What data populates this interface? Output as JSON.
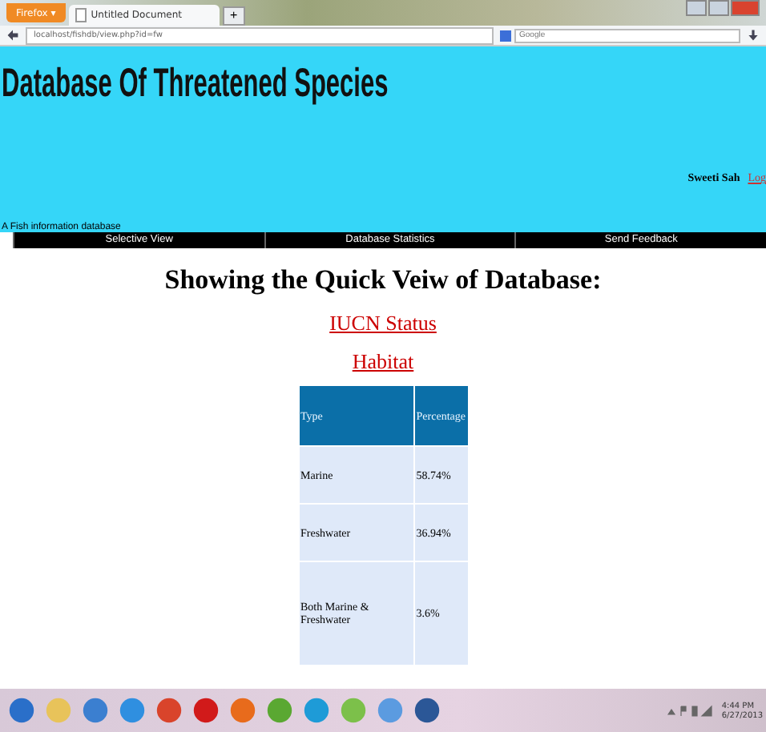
{
  "browser": {
    "menu_button": "Firefox ▾",
    "tabs": [
      {
        "title": "Untitled Document",
        "selected": true
      }
    ],
    "new_tab": "+",
    "url": "localhost/fishdb/view.php?id=fw",
    "search_placeholder": "Google"
  },
  "site": {
    "title": "Database Of Threatened Species",
    "user": "Sweeti Sah",
    "logout": "Log",
    "tagline": "A Fish information database",
    "nav": [
      "Selective View",
      "Database Statistics",
      "Send Feedback"
    ]
  },
  "content": {
    "heading": "Showing the Quick Veiw of Database:",
    "links": [
      "IUCN Status",
      "Habitat"
    ],
    "table": {
      "columns": [
        "Type",
        "Percentage"
      ],
      "rows": [
        [
          "Marine",
          "58.74%"
        ],
        [
          "Freshwater",
          "36.94%"
        ],
        [
          "Both Marine & Freshwater",
          "3.6%"
        ]
      ]
    }
  },
  "taskbar": {
    "time": "4:44 PM",
    "date": "6/27/2013"
  }
}
